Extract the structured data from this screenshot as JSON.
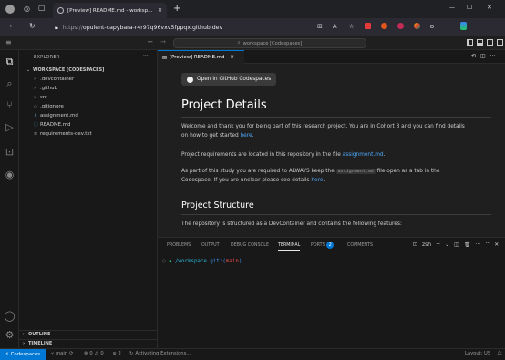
{
  "browser": {
    "tab_title": "[Preview] README.md - worksp...",
    "new_tab": "+",
    "url_prefix": "https://",
    "url_host": "opulent-capybara-r4r97q96vxv5fppqx.github.dev",
    "window_min": "—",
    "window_max": "☐",
    "window_close": "✕"
  },
  "vscode": {
    "command_center": "workspace [Codespaces]",
    "explorer_title": "EXPLORER",
    "explorer_more": "···",
    "workspace_header": "WORKSPACE [CODESPACES]",
    "tree": [
      {
        "label": ".devcontainer",
        "type": "folder"
      },
      {
        "label": ".github",
        "type": "folder"
      },
      {
        "label": "src",
        "type": "folder"
      },
      {
        "label": ".gitignore",
        "type": "file",
        "icon": "◇"
      },
      {
        "label": "assignment.md",
        "type": "file",
        "icon": "⬇"
      },
      {
        "label": "README.md",
        "type": "file",
        "icon": "ⓘ"
      },
      {
        "label": "requirements-dev.txt",
        "type": "file",
        "icon": "≡"
      }
    ],
    "outline": "OUTLINE",
    "timeline": "TIMELINE",
    "editor_tab": "[Preview] README.md",
    "preview": {
      "button": "Open in GitHub Codespaces",
      "h1": "Project Details",
      "p1_a": "Welcome and thank you for being part of this research project. You are in Cohort 3 and you can find details",
      "p1_b": "on how to get started ",
      "p1_link": "here",
      "p1_end": ".",
      "p2_a": "Project requirements are located in this repository in the file ",
      "p2_link": "assignment.md",
      "p2_end": ".",
      "p3_a": "As part of this study you are required to ALWAYS keep the ",
      "p3_code": "assignment.md",
      "p3_b": " file open as a tab in the",
      "p3_c": "Codespace. If you are unclear please see details ",
      "p3_link": "here",
      "p3_end": ".",
      "h2": "Project Structure",
      "p4": "The repository is structured as a DevContainer and contains the following features:"
    },
    "panel": {
      "tabs": [
        "PROBLEMS",
        "OUTPUT",
        "DEBUG CONSOLE",
        "TERMINAL",
        "PORTS",
        "COMMENTS"
      ],
      "ports_badge": "2",
      "shell": "zsh",
      "prompt_path": "/workspace",
      "prompt_git": "git:(",
      "prompt_branch": "main",
      "prompt_close": ")"
    },
    "status": {
      "remote": "Codespaces",
      "branch": "main",
      "errors": "0",
      "warnings": "0",
      "ports": "2",
      "activating": "Activating Extensions...",
      "layout": "Layout: US"
    }
  },
  "colors": {
    "accent": "#0078d4",
    "link": "#4daafc",
    "prompt": "#23d18b"
  }
}
